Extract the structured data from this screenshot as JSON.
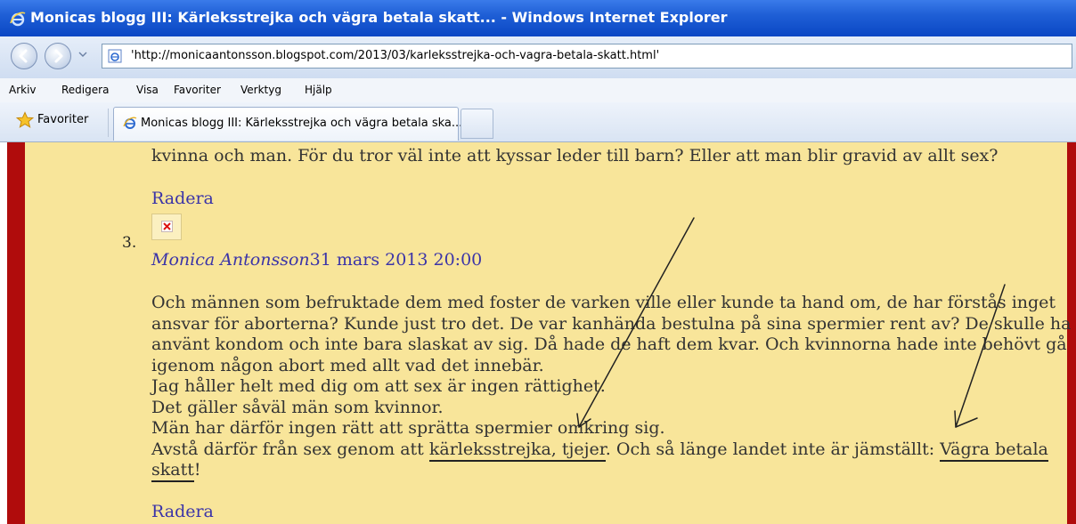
{
  "window": {
    "title": "Monicas blogg III: Kärleksstrejka och vägra betala skatt... - Windows Internet Explorer"
  },
  "address_bar": {
    "url": "'http://monicaantonsson.blogspot.com/2013/03/karleksstrejka-och-vagra-betala-skatt.html'"
  },
  "menu": {
    "items": [
      "Arkiv",
      "Redigera",
      "Visa",
      "Favoriter",
      "Verktyg",
      "Hjälp"
    ]
  },
  "favorites_bar": {
    "label": "Favoriter"
  },
  "tabs": [
    {
      "label": "Monicas blogg III: Kärleksstrejka och vägra betala ska..."
    }
  ],
  "page": {
    "previous_comment_tail": "kvinna och man. För du tror väl inte att kyssar leder till barn? Eller att man blir gravid av allt sex?",
    "delete_label": "Radera",
    "comment": {
      "number": "3.",
      "author": "Monica Antonsson",
      "timestamp": "31 mars 2013 20:00",
      "lines": [
        "Och männen som befruktade dem med foster de varken ville eller kunde ta hand om, de har förstås inget",
        "ansvar för aborterna? Kunde just tro det. De var kanhända bestulna på sina spermier rent av? De skulle ha",
        "använt kondom och inte bara slaskat av sig. Då hade de haft dem kvar. Och kvinnorna hade inte behövt gå",
        "igenom någon abort med allt vad det innebär.",
        "Jag håller helt med dig om att sex är ingen rättighet.",
        "Det gäller såväl män som kvinnor.",
        "Män har därför ingen rätt att sprätta spermier omkring sig."
      ],
      "last_line": {
        "before": "Avstå därför från sex genom att ",
        "underlined_1": "kärleksstrejka, tjejer",
        "middle": ". Och så länge landet inte är jämställt: ",
        "underlined_2": "Vägra betala"
      },
      "final_line": "skatt",
      "final_punct": "!"
    }
  },
  "colors": {
    "page_background": "#f8e59a",
    "side_bars": "#b00c0c",
    "link": "#3b34a8",
    "titlebar": "#0a47c4"
  }
}
